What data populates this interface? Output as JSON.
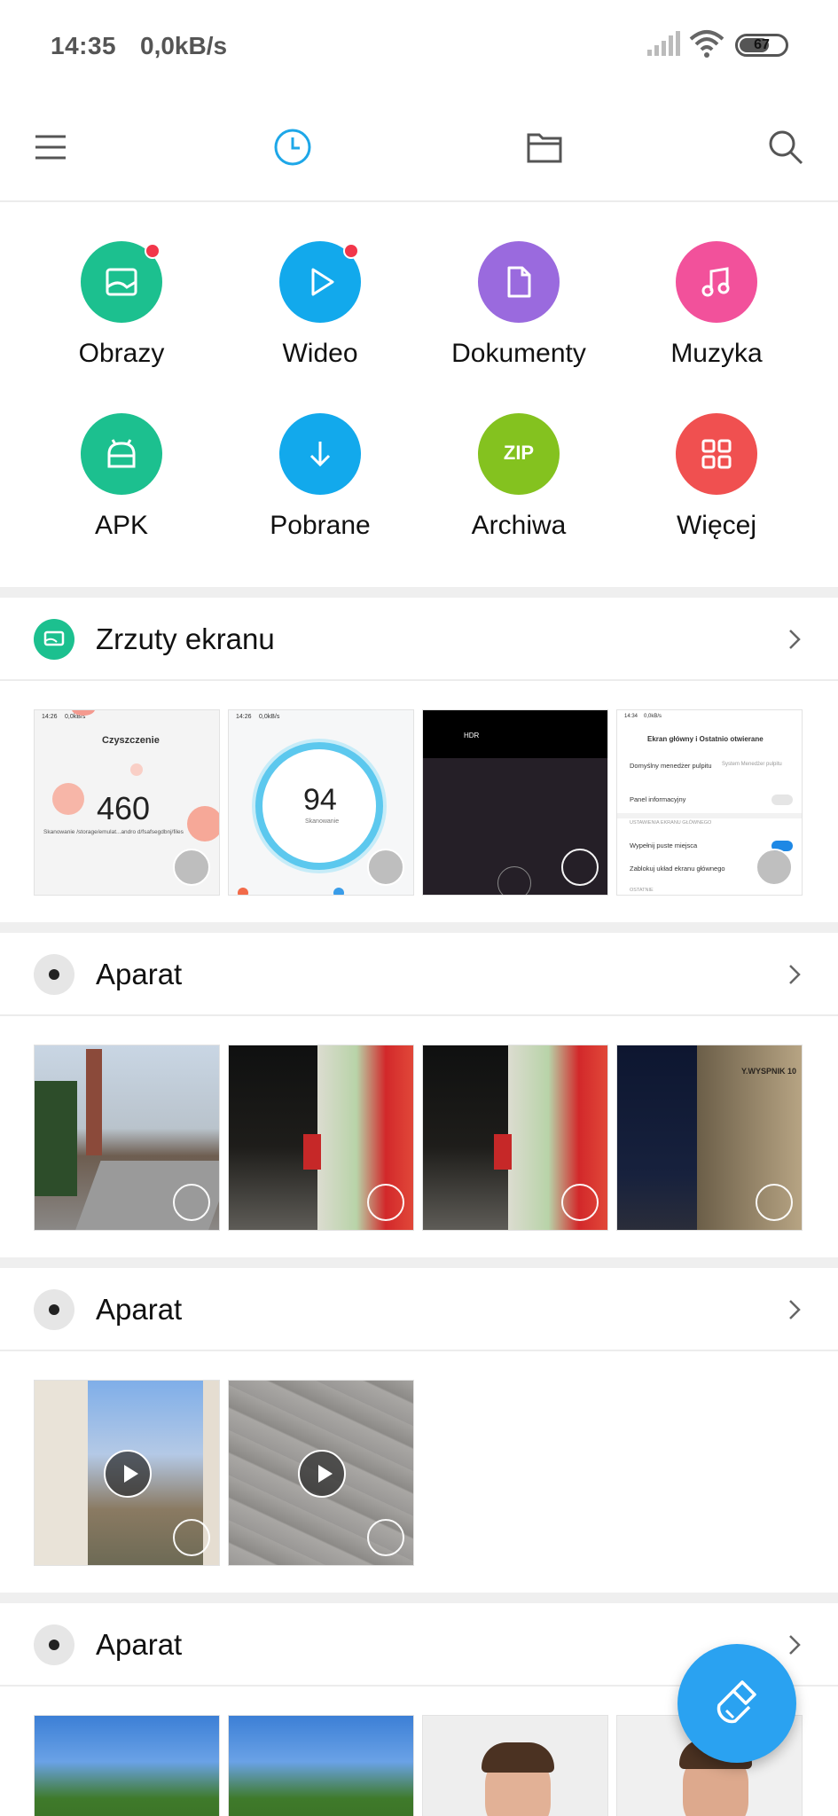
{
  "status_bar": {
    "time": "14:35",
    "net_speed": "0,0kB/s",
    "battery": "67"
  },
  "toolbar": {
    "icons": [
      "menu-icon",
      "recent-clock-icon",
      "folder-icon",
      "search-icon"
    ],
    "active_color": "#1ea7e8"
  },
  "categories": [
    {
      "label": "Obrazy",
      "color": "#1cc08f",
      "icon": "image-icon",
      "badge": true
    },
    {
      "label": "Wideo",
      "color": "#12a9ec",
      "icon": "play-icon",
      "badge": true
    },
    {
      "label": "Dokumenty",
      "color": "#9a6ade",
      "icon": "document-icon",
      "badge": false
    },
    {
      "label": "Muzyka",
      "color": "#f2519b",
      "icon": "music-icon",
      "badge": false
    },
    {
      "label": "APK",
      "color": "#1cc08f",
      "icon": "android-icon",
      "badge": false
    },
    {
      "label": "Pobrane",
      "color": "#12a9ec",
      "icon": "download-icon",
      "badge": false
    },
    {
      "label": "Archiwa",
      "color": "#84c21f",
      "icon": "zip-icon",
      "zip_label": "ZIP",
      "badge": false
    },
    {
      "label": "Więcej",
      "color": "#f05050",
      "icon": "grid-icon",
      "badge": false
    }
  ],
  "sections": [
    {
      "title": "Zrzuty ekranu",
      "icon": "screenshot-icon",
      "thumbs": [
        {
          "kind": "screenshot-cleaner",
          "time": "14:26",
          "speed": "0,0kB/s",
          "title": "Czyszczenie",
          "value": "460",
          "caption": "Skanowanie /storage/emulat...andro d/fsafsegdbnj/files"
        },
        {
          "kind": "screenshot-score",
          "time": "14:26",
          "speed": "0,0kB/s",
          "value": "94",
          "caption": "Skanowanie"
        },
        {
          "kind": "screenshot-camera",
          "hdr": "HDR"
        },
        {
          "kind": "screenshot-settings",
          "time": "14:34",
          "speed": "0,0kB/s",
          "title": "Ekran główny i Ostatnio otwierane",
          "row1": "Domyślny menedżer pulpitu",
          "row1_value": "System Menedżer pulpitu",
          "row2": "Panel informacyjny",
          "section": "USTAWIENIA EKRANU GŁÓWNEGO",
          "row3": "Wypełnij puste miejsca",
          "row4": "Zablokuj układ ekranu głównego",
          "row5": "OSTATNIE"
        }
      ]
    },
    {
      "title": "Aparat",
      "icon": "camera-icon",
      "thumbs": [
        {
          "kind": "photo-church"
        },
        {
          "kind": "photo-night-shop"
        },
        {
          "kind": "photo-night-shop-2"
        },
        {
          "kind": "photo-night-building",
          "sign": "Y.WYSPNIK 10"
        }
      ]
    },
    {
      "title": "Aparat",
      "icon": "camera-icon",
      "thumbs": [
        {
          "kind": "video-alley"
        },
        {
          "kind": "video-pavement"
        }
      ]
    },
    {
      "title": "Aparat",
      "icon": "camera-icon",
      "thumbs": [
        {
          "kind": "photo-trees"
        },
        {
          "kind": "photo-trees-2"
        },
        {
          "kind": "photo-face"
        },
        {
          "kind": "photo-face-2"
        }
      ]
    }
  ],
  "fab": {
    "icon": "broom-clean-icon",
    "color": "#2aa2f1"
  }
}
